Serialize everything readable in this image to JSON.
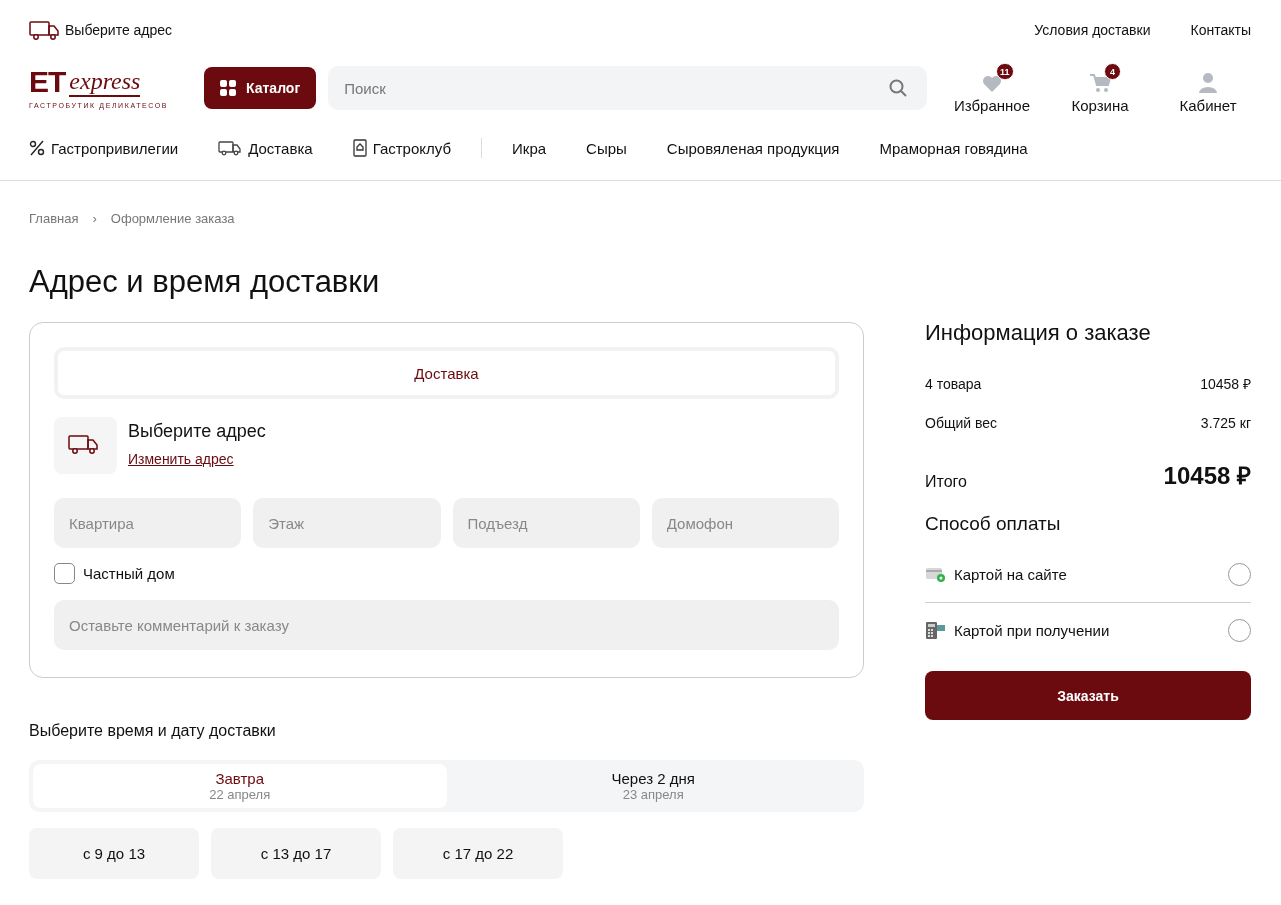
{
  "topbar": {
    "address": "Выберите адрес",
    "links": [
      "Условия доставки",
      "Контакты"
    ]
  },
  "logo": {
    "mark": "ET",
    "word": "express",
    "tagline": "ГАСТРОБУТИК ДЕЛИКАТЕСОВ"
  },
  "catalog_button": "Каталог",
  "search": {
    "placeholder": "Поиск"
  },
  "header_actions": [
    {
      "label": "Избранное",
      "badge": "11"
    },
    {
      "label": "Корзина",
      "badge": "4"
    },
    {
      "label": "Кабинет"
    }
  ],
  "nav": {
    "features": [
      "Гастропривилегии",
      "Доставка",
      "Гастроклуб"
    ],
    "categories": [
      "Икра",
      "Сыры",
      "Сыровяленая продукция",
      "Мраморная говядина"
    ]
  },
  "breadcrumbs": [
    "Главная",
    "›",
    "Оформление заказа"
  ],
  "title": "Адрес и время доставки",
  "delivery_card": {
    "tabs": [
      {
        "label": "Доставка",
        "selected": true
      }
    ],
    "address_title": "Выберите адрес",
    "change_link": "Изменить адрес",
    "fields": [
      {
        "placeholder": "Квартира"
      },
      {
        "placeholder": "Этаж"
      },
      {
        "placeholder": "Подъезд"
      },
      {
        "placeholder": "Домофон"
      }
    ],
    "private_house": {
      "label": "Частный дом",
      "checked": false
    },
    "comment": {
      "placeholder": "Оставьте комментарий к заказу"
    }
  },
  "time_section": {
    "title": "Выберите время и дату доставки",
    "days": [
      {
        "label": "Завтра",
        "date": "22 апреля",
        "selected": true
      },
      {
        "label": "Через 2 дня",
        "date": "23 апреля",
        "selected": false
      }
    ],
    "slots": [
      {
        "label": "с 9 до 13",
        "selected": false
      },
      {
        "label": "с 13 до 17",
        "selected": false
      },
      {
        "label": "с 17 до 22",
        "selected": false
      }
    ]
  },
  "order_info": {
    "title": "Информация о заказе",
    "rows": [
      {
        "label": "4 товара",
        "value": "10458 ₽"
      },
      {
        "label": "Общий вес",
        "value": "3.725 кг"
      }
    ],
    "total": {
      "label": "Итого",
      "value": "10458 ₽"
    },
    "payment_title": "Способ оплаты",
    "payments": [
      {
        "label": "Картой на сайте",
        "selected": false
      },
      {
        "label": "Картой при получении",
        "selected": false
      }
    ],
    "submit": "Заказать"
  }
}
